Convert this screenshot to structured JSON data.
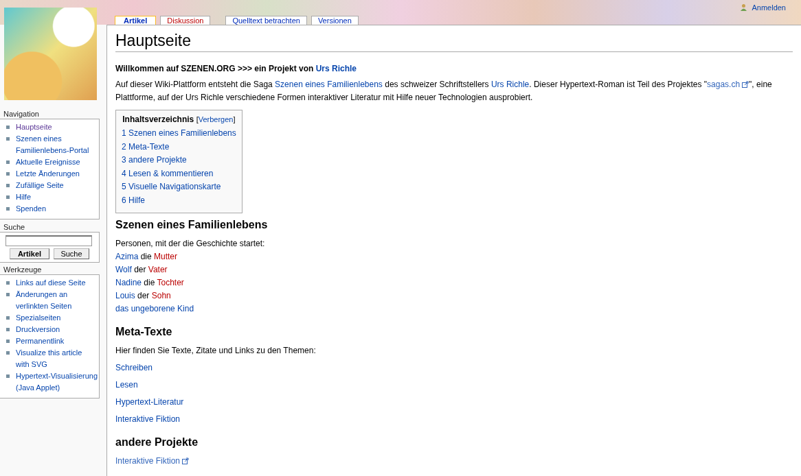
{
  "user_link": "Anmelden",
  "tabs": [
    {
      "label": "Artikel",
      "selected": true,
      "missing": false
    },
    {
      "label": "Diskussion",
      "selected": false,
      "missing": true
    },
    {
      "label": "Quelltext betrachten",
      "selected": false,
      "missing": false
    },
    {
      "label": "Versionen",
      "selected": false,
      "missing": false
    }
  ],
  "sidebar": {
    "navigation": {
      "title": "Navigation",
      "items": [
        [
          "Hauptseite"
        ],
        [
          "Szenen eines",
          "Familienlebens-Portal"
        ],
        [
          "Aktuelle Ereignisse"
        ],
        [
          "Letzte Änderungen"
        ],
        [
          "Zufällige Seite"
        ],
        [
          "Hilfe"
        ],
        [
          "Spenden"
        ]
      ]
    },
    "search": {
      "title": "Suche",
      "buttons": [
        "Artikel",
        "Suche"
      ]
    },
    "tools": {
      "title": "Werkzeuge",
      "items": [
        [
          "Links auf diese Seite"
        ],
        [
          "Änderungen an",
          "verlinkten Seiten"
        ],
        [
          "Spezialseiten"
        ],
        [
          "Druckversion"
        ],
        [
          "Permanentlink"
        ],
        [
          "Visualize this article",
          "with SVG"
        ],
        [
          "Hypertext-Visualisierung",
          "(Java Applet)"
        ]
      ]
    }
  },
  "page_title": "Hauptseite",
  "welcome": [
    {
      "kind": "text",
      "text": "Willkommen auf SZENEN.ORG >>> ein Projekt von "
    },
    {
      "kind": "link",
      "text": "Urs Richle"
    }
  ],
  "intro": [
    {
      "kind": "text",
      "text": "Auf dieser Wiki-Plattform entsteht die Saga "
    },
    {
      "kind": "link",
      "text": "Szenen eines Familienlebens"
    },
    {
      "kind": "text",
      "text": " des schweizer Schriftstellers "
    },
    {
      "kind": "link",
      "text": "Urs Richle"
    },
    {
      "kind": "text",
      "text": ". Dieser Hypertext-Roman ist Teil des Projektes \""
    },
    {
      "kind": "external",
      "text": "sagas.ch"
    },
    {
      "kind": "text",
      "text": "\", eine Plattforme, auf der Urs Richle verschiedene Formen interaktiver Literatur mit Hilfe neuer Technologien ausprobiert."
    }
  ],
  "toc": {
    "title": "Inhaltsverzeichnis",
    "toggle_open": "[",
    "toggle": "Verbergen",
    "toggle_close": "]",
    "items": [
      "1 Szenen eines Familienlebens",
      "2 Meta-Texte",
      "3 andere Projekte",
      "4 Lesen & kommentieren",
      "5 Visuelle Navigationskarte",
      "6 Hilfe"
    ]
  },
  "sections": [
    {
      "heading": "Szenen eines Familienlebens",
      "intro": "Personen, mit der die Geschichte startet:",
      "spaced": false,
      "lines": [
        [
          {
            "kind": "link",
            "text": "Azima"
          },
          {
            "kind": "text",
            "text": " die "
          },
          {
            "kind": "missing",
            "text": "Mutter"
          }
        ],
        [
          {
            "kind": "link",
            "text": "Wolf"
          },
          {
            "kind": "text",
            "text": " der "
          },
          {
            "kind": "missing",
            "text": "Vater"
          }
        ],
        [
          {
            "kind": "link",
            "text": "Nadine"
          },
          {
            "kind": "text",
            "text": " die "
          },
          {
            "kind": "missing",
            "text": "Tochter"
          }
        ],
        [
          {
            "kind": "link",
            "text": "Louis"
          },
          {
            "kind": "text",
            "text": " der "
          },
          {
            "kind": "missing",
            "text": "Sohn"
          }
        ],
        [
          {
            "kind": "link",
            "text": "das ungeborene Kind"
          }
        ]
      ]
    },
    {
      "heading": "Meta-Texte",
      "intro": "Hier finden Sie Texte, Zitate und Links zu den Themen:",
      "spaced": true,
      "lines": [
        [
          {
            "kind": "link",
            "text": "Schreiben"
          }
        ],
        [
          {
            "kind": "link",
            "text": "Lesen"
          }
        ],
        [
          {
            "kind": "link",
            "text": "Hypertext-Literatur"
          }
        ],
        [
          {
            "kind": "link",
            "text": "Interaktive Fiktion"
          }
        ]
      ]
    },
    {
      "heading": "andere Projekte",
      "spaced": false,
      "lines": [
        [
          {
            "kind": "external",
            "text": "Interaktive Fiktion"
          }
        ]
      ]
    }
  ]
}
